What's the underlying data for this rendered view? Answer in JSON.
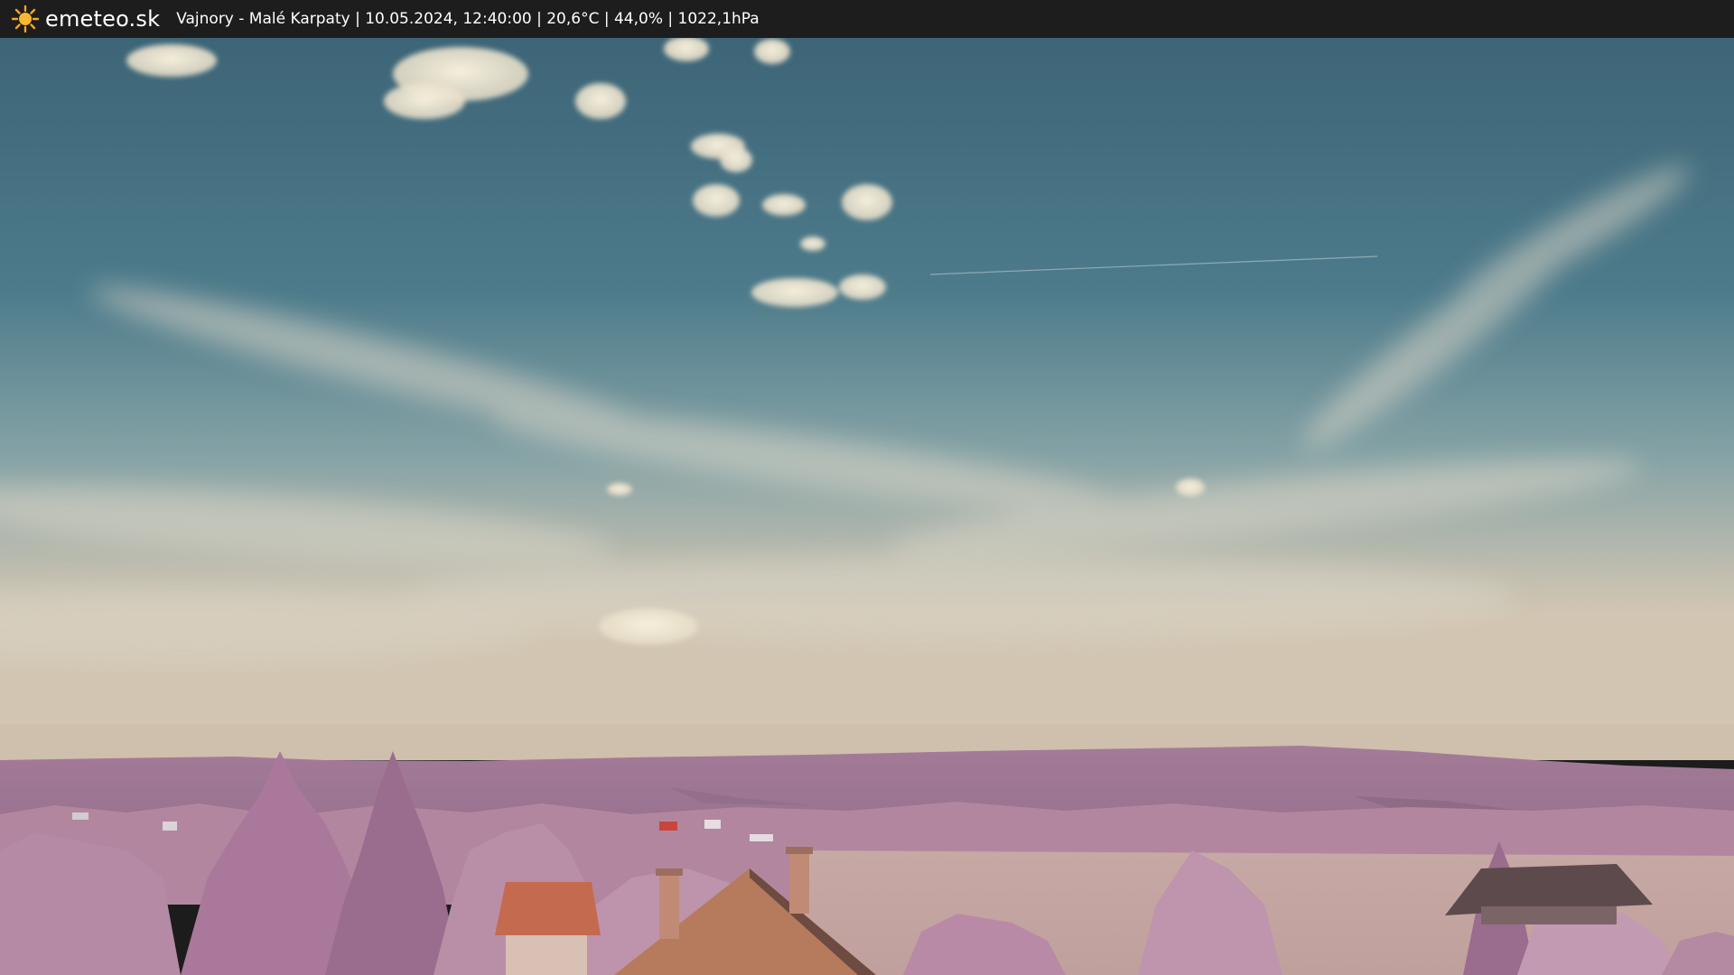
{
  "brand": {
    "name": "emeteo.sk",
    "icon": "sun-icon",
    "icon_color": "#f5a623"
  },
  "caption": {
    "text": "Vajnory - Malé Karpaty | 10.05.2024, 12:40:00 | 20,6°C | 44,0% | 1022,1hPa"
  },
  "colors": {
    "bar_background": "#1d1d1d",
    "sky_top": "#3e6778",
    "sky_horizon": "#cfc3b0",
    "hills": "#a27a96",
    "foliage": "#b98aa6",
    "roof": "#c46a4f"
  }
}
